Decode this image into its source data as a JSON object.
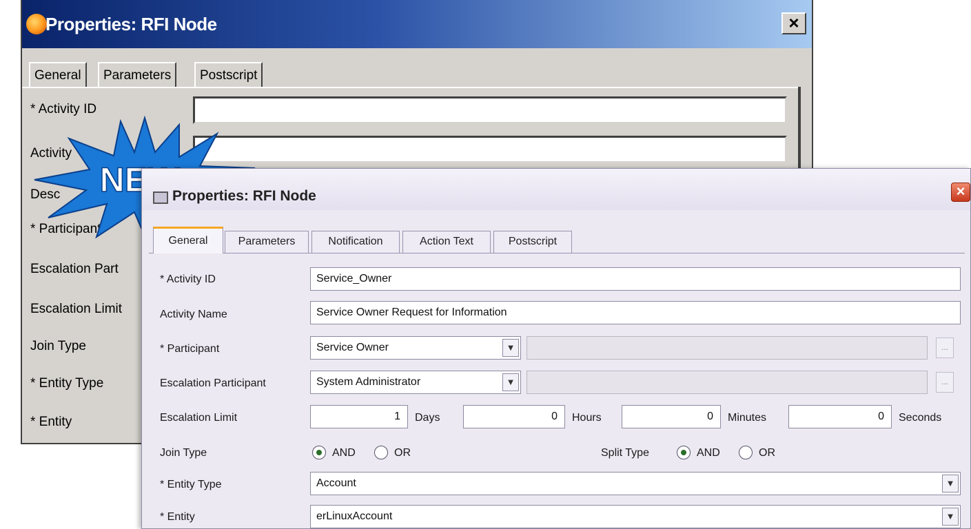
{
  "old_dialog": {
    "title": "Properties: RFI Node",
    "close_label": "×",
    "tabs": [
      "General",
      "Parameters",
      "Postscript"
    ],
    "labels": [
      "* Activity ID",
      "Activity",
      "Desc",
      "* Participant",
      "Escalation Part",
      "Escalation Limit",
      "Join Type",
      "* Entity Type",
      "* Entity"
    ]
  },
  "badge": {
    "text": "NEW"
  },
  "new_dialog": {
    "title": "Properties: RFI Node",
    "close_label": "×",
    "tabs": [
      "General",
      "Parameters",
      "Notification",
      "Action Text",
      "Postscript"
    ],
    "active_tab": "General",
    "fields": {
      "activity_id": {
        "label": "* Activity ID",
        "value": "Service_Owner"
      },
      "activity_name": {
        "label": "Activity Name",
        "value": "Service Owner Request for Information"
      },
      "participant": {
        "label": "* Participant",
        "value": "Service Owner"
      },
      "escalation_participant": {
        "label": "Escalation Participant",
        "value": "System Administrator"
      },
      "escalation_limit": {
        "label": "Escalation Limit",
        "days": "1",
        "days_label": "Days",
        "hours": "0",
        "hours_label": "Hours",
        "minutes": "0",
        "minutes_label": "Minutes",
        "seconds": "0",
        "seconds_label": "Seconds"
      },
      "join_type": {
        "label": "Join Type",
        "options": [
          "AND",
          "OR"
        ],
        "selected": "AND"
      },
      "split_type": {
        "label": "Split Type",
        "options": [
          "AND",
          "OR"
        ],
        "selected": "AND"
      },
      "entity_type": {
        "label": "* Entity Type",
        "value": "Account"
      },
      "entity": {
        "label": "* Entity",
        "value": "erLinuxAccount"
      }
    },
    "browse_button_label": "..."
  }
}
